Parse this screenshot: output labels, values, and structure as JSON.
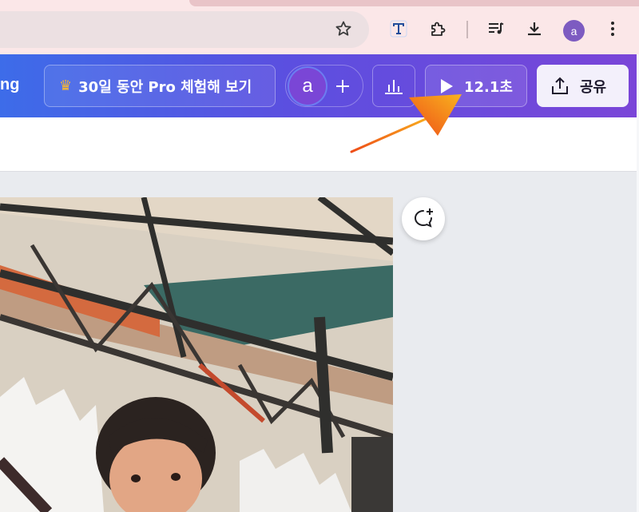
{
  "browser": {
    "profile_initial": "a",
    "icons": [
      "bookmark-star-icon",
      "text-extension-icon",
      "extensions-puzzle-icon",
      "media-queue-icon",
      "download-icon",
      "more-vert-icon"
    ]
  },
  "canva_header": {
    "brand_fragment": "ng",
    "trial_button_label": "30일 동안 Pro 체험해 보기",
    "collaborator_initial": "a",
    "present_duration": "12.1초",
    "share_label": "공유",
    "colors": {
      "gradient_start": "#3d6ce9",
      "gradient_end": "#7a45d8",
      "crown": "#f7b733",
      "share_bg": "#f3f0fb"
    }
  },
  "canvas": {
    "comment_icon": "add-comment-icon"
  },
  "annotation": {
    "arrow_color": "#f7931e"
  }
}
